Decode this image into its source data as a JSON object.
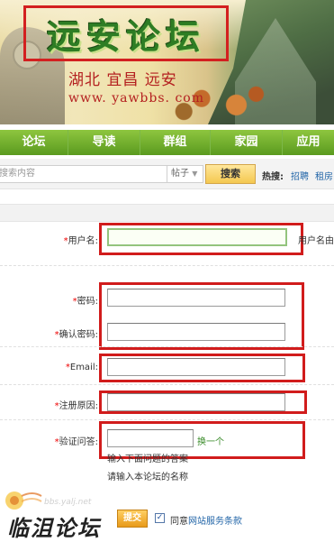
{
  "banner": {
    "logo": "远安论坛",
    "city": "湖北 宜昌 远安",
    "url": "www. yawbbs. com"
  },
  "nav": {
    "items": [
      "论坛",
      "导读",
      "群组",
      "家园",
      "应用"
    ]
  },
  "search": {
    "placeholder": "搜索内容",
    "type": "帖子",
    "button": "搜索",
    "hot_label": "热搜:",
    "hot_links": [
      "招聘",
      "租房"
    ]
  },
  "form": {
    "username_label": "用户名:",
    "username_hint": "用户名由",
    "password_label": "密码:",
    "confirm_label": "确认密码:",
    "email_label": "Email:",
    "reason_label": "注册原因:",
    "question_label": "验证问答:",
    "change_link": "换一个",
    "question_hint": "输入下面问题的答案",
    "question_text": "请输入本论坛的名称",
    "required_mark": "*",
    "submit": "提交",
    "agree_prefix": "同意",
    "agree_link": "网站服务条款"
  },
  "watermark": {
    "url": "bbs.yalj.net",
    "text": "临沮论坛"
  },
  "colors": {
    "nav_green": "#5a9a1f",
    "annotation_red": "#d11c1c",
    "logo_green": "#2e7d24",
    "required_red": "#e00"
  }
}
